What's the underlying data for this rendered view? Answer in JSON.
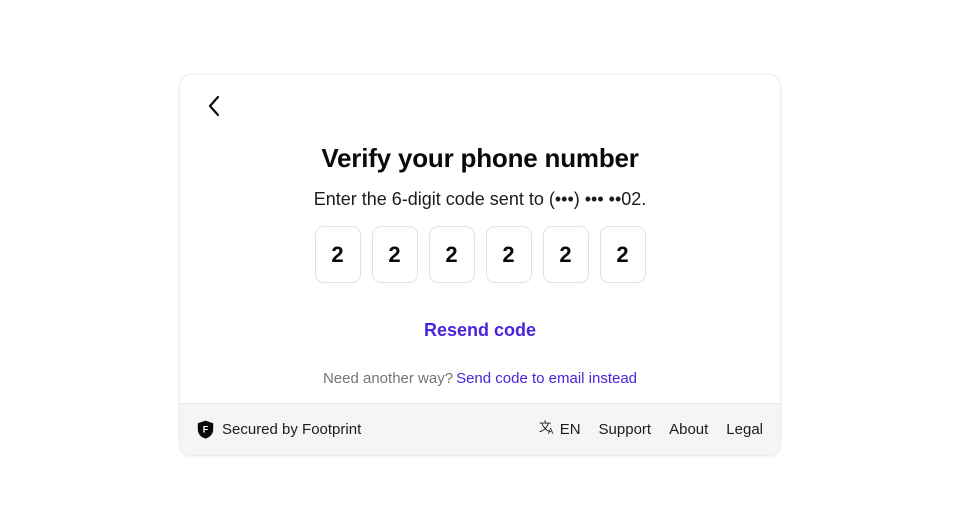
{
  "card": {
    "back_button_icon": "chevron-left-icon",
    "title": "Verify your phone number",
    "subtitle": "Enter the 6-digit code sent to (•••) ••• ••02.",
    "otp": {
      "length": 6,
      "digits": [
        "2",
        "2",
        "2",
        "2",
        "2",
        "2"
      ]
    },
    "resend_label": "Resend code",
    "alternate": {
      "prompt": "Need another way?",
      "link_label": "Send code to email instead"
    }
  },
  "footer": {
    "secured_label": "Secured by Footprint",
    "brand_mark": "F",
    "language": {
      "icon": "translate-icon",
      "code": "EN"
    },
    "links": [
      {
        "label": "Support"
      },
      {
        "label": "About"
      },
      {
        "label": "Legal"
      }
    ]
  },
  "colors": {
    "accent": "#4A24DB",
    "page_background": "#FFFFFF",
    "card_background": "#FFFFFF",
    "footer_background": "#F5F5F5",
    "border": "#E3E3E3",
    "muted_text": "#757575",
    "text": "#0A0A0A"
  }
}
